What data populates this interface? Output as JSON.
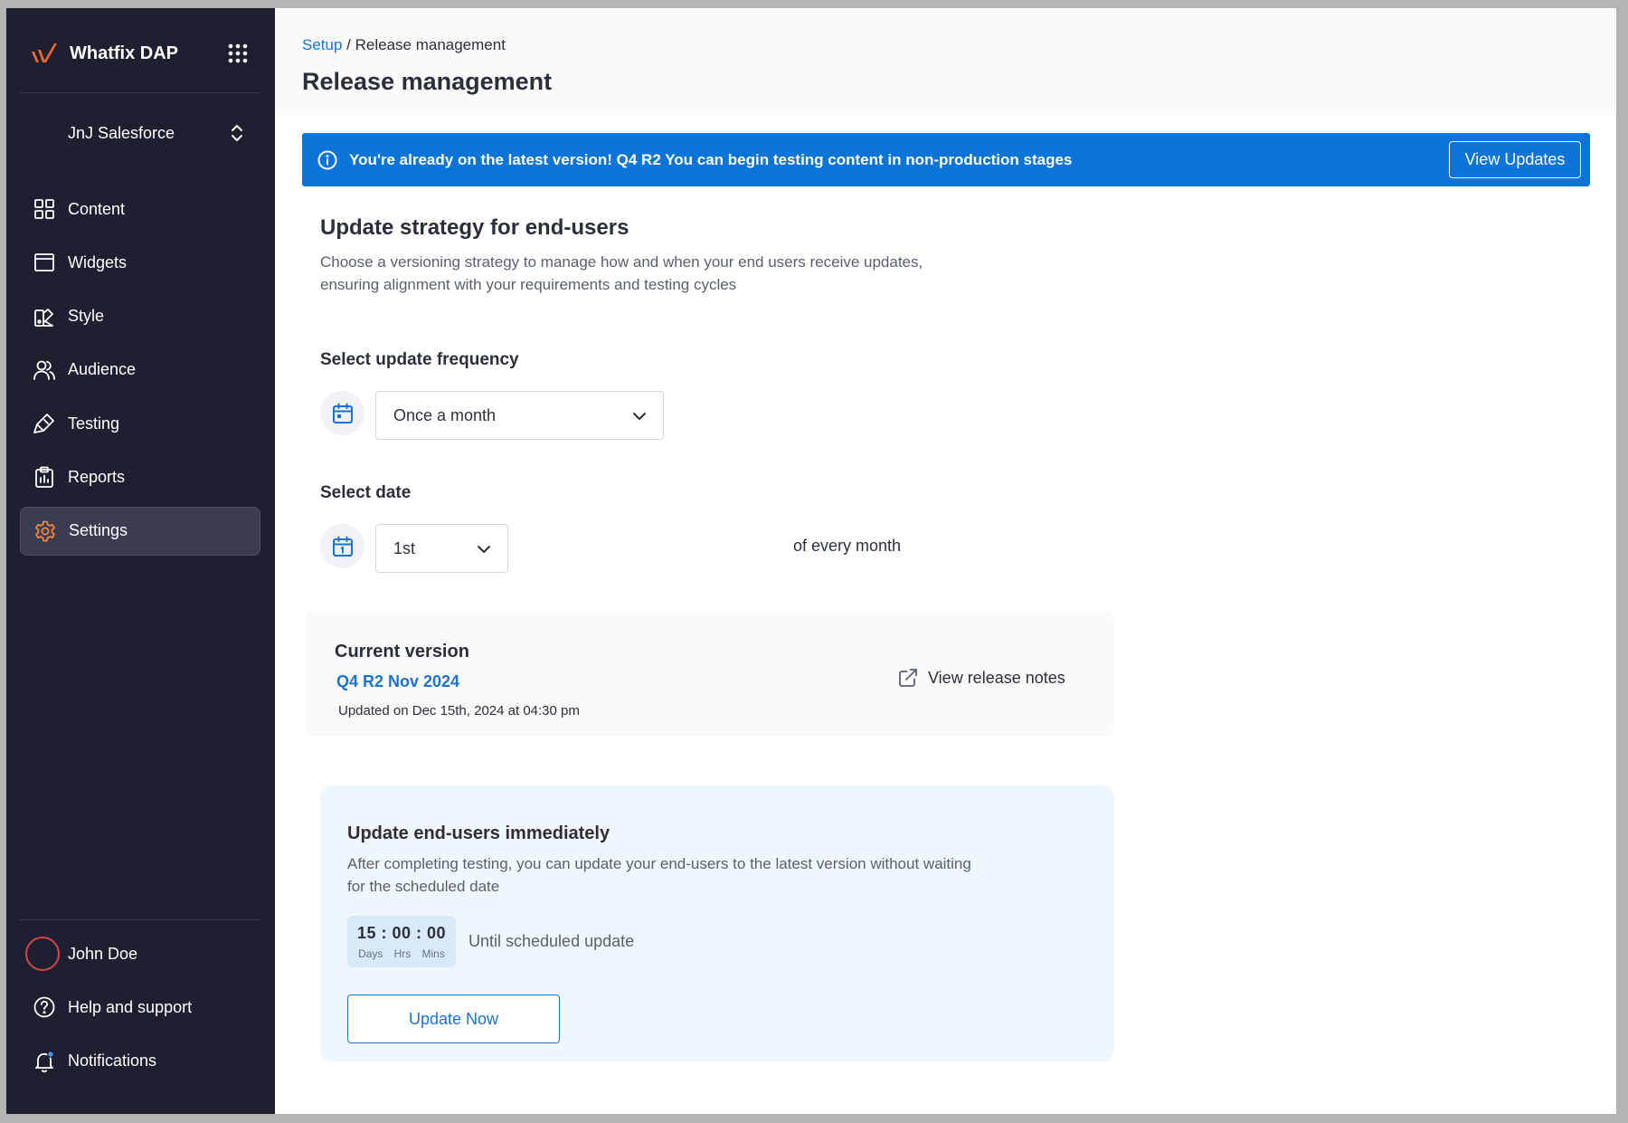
{
  "app": {
    "brand_name": "Whatfix DAP",
    "colors": {
      "sidebar_bg": "#1e1f30",
      "accent": "#1a73d0",
      "banner": "#0b74d9",
      "logo": "#f06a2a",
      "settings_icon": "#f0883e"
    }
  },
  "sidebar": {
    "org_name": "JnJ Salesforce",
    "items": [
      {
        "label": "Content",
        "icon": "grid-icon"
      },
      {
        "label": "Widgets",
        "icon": "widget-window-icon"
      },
      {
        "label": "Style",
        "icon": "palette-icon"
      },
      {
        "label": "Audience",
        "icon": "users-icon"
      },
      {
        "label": "Testing",
        "icon": "test-brush-icon"
      },
      {
        "label": "Reports",
        "icon": "clipboard-icon"
      },
      {
        "label": "Settings",
        "icon": "gear-icon",
        "active": true
      }
    ],
    "bottom": {
      "user_name": "John Doe",
      "help_label": "Help and support",
      "notifications_label": "Notifications"
    }
  },
  "header": {
    "breadcrumb": {
      "root": "Setup",
      "separator": " / ",
      "current": "Release management"
    },
    "title": "Release management"
  },
  "banner": {
    "message": "You're already on the latest version! Q4 R2 You can begin testing content in non-production stages",
    "button_label": "View Updates"
  },
  "strategy": {
    "title": "Update strategy for end-users",
    "description": "Choose a versioning strategy to manage how and when your end users receive updates, ensuring alignment with your requirements and testing cycles",
    "frequency_label": "Select update frequency",
    "frequency_value": "Once a month",
    "date_label": "Select date",
    "date_value": "1st",
    "date_suffix": "of every month"
  },
  "current_version": {
    "title": "Current version",
    "version": "Q4 R2 Nov 2024",
    "updated": "Updated on Dec 15th, 2024 at 04:30 pm",
    "release_notes_label": "View release notes"
  },
  "immediate_update": {
    "title": "Update end-users immediately",
    "description": "After completing testing, you can update your end-users to the latest version without waiting for the scheduled date",
    "countdown": {
      "display": "15 : 00 : 00",
      "days_unit": "Days",
      "hrs_unit": "Hrs",
      "mins_unit": "Mins"
    },
    "countdown_caption": "Until scheduled update",
    "button_label": "Update Now"
  }
}
